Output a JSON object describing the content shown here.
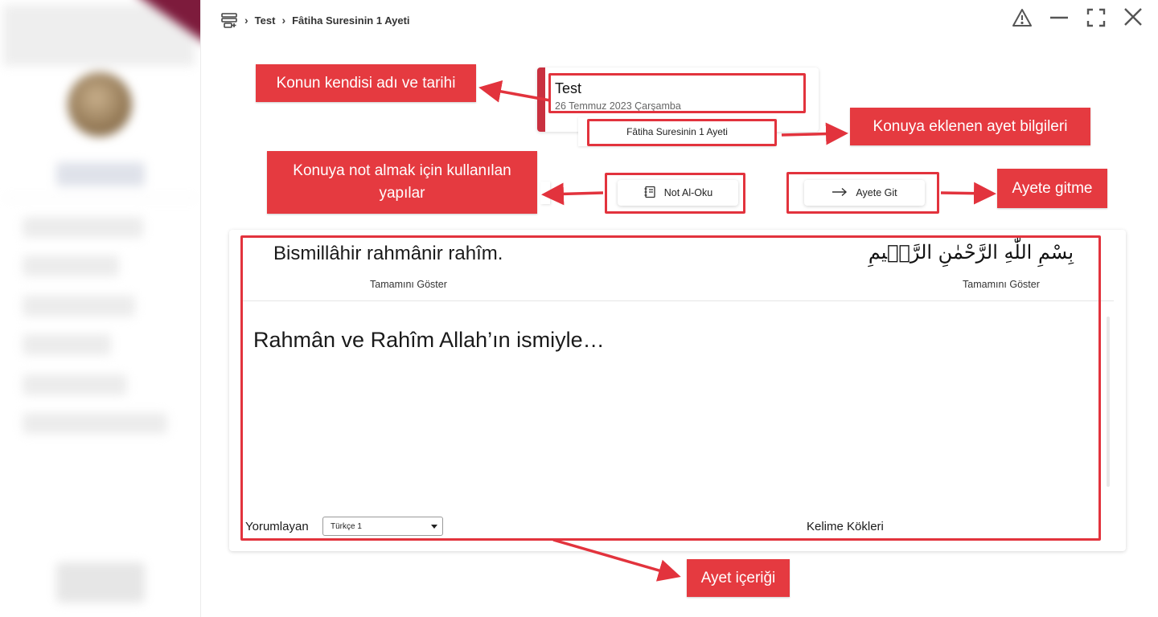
{
  "breadcrumb": {
    "items": [
      "Test",
      "Fâtiha Suresinin 1 Ayeti"
    ]
  },
  "window": {
    "controls": [
      "warning-icon",
      "minimize-icon",
      "fullscreen-icon",
      "close-icon"
    ]
  },
  "topic": {
    "title": "Test",
    "date": "26 Temmuz 2023 Çarşamba",
    "verse_tag": "Fâtiha Suresinin 1 Ayeti"
  },
  "actions": {
    "note_label": "Not Al-Oku",
    "goto_label": "Ayete Git"
  },
  "verse": {
    "transliteration": "Bismillâhir rahmânir rahîm.",
    "arabic": "بِسْمِ اللّٰهِ الرَّحْمٰنِ الرَّح۪يمِ",
    "show_all_left": "Tamamını Göster",
    "show_all_right": "Tamamını Göster",
    "meaning": "Rahmân ve Rahîm Allah’ın ismiyle…",
    "commentator_label": "Yorumlayan",
    "commentator_value": "Türkçe 1",
    "word_roots": "Kelime Kökleri"
  },
  "annotations": {
    "topic_name_date": "Konun kendisi adı ve tarihi",
    "verse_info": "Konuya eklenen ayet bilgileri",
    "note_tools": "Konuya not almak için kullanılan yapılar",
    "go_to_verse": "Ayete gitme",
    "verse_content": "Ayet içeriği"
  },
  "colors": {
    "accent": "#c9303f",
    "annotation": "#e53a40",
    "highlight": "#e2333d"
  }
}
